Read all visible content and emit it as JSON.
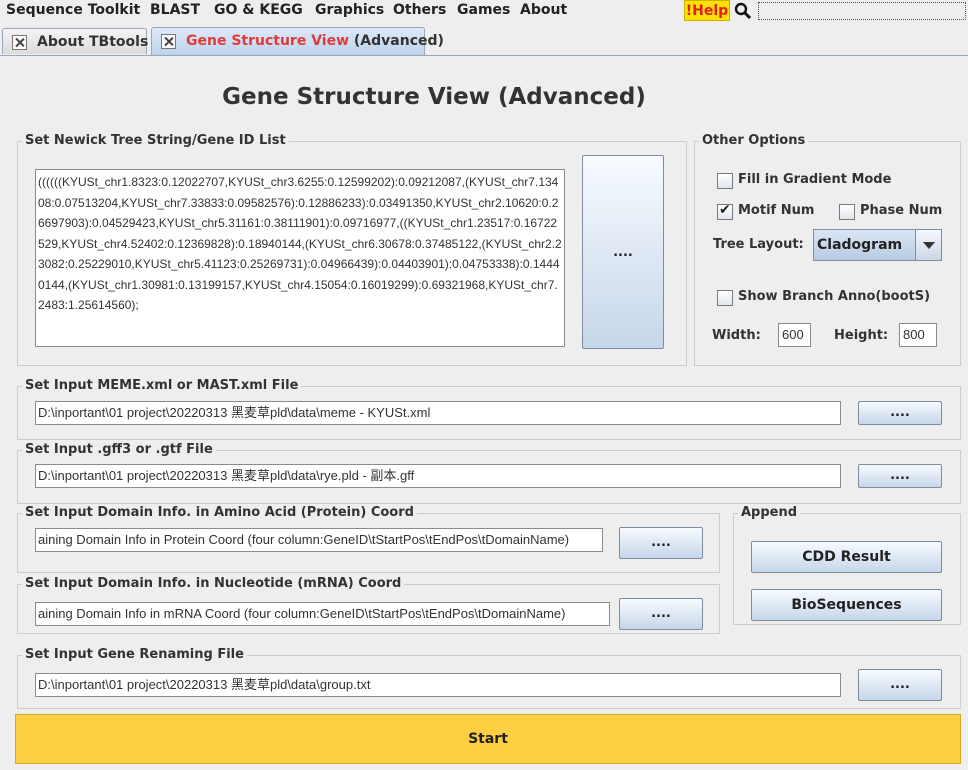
{
  "menu": {
    "items": [
      "Sequence Toolkit",
      "BLAST",
      "GO & KEGG",
      "Graphics",
      "Others",
      "Games",
      "About"
    ],
    "help_label": "!Help",
    "search_icon": "magnifier-icon"
  },
  "tabs": [
    {
      "label": "About TBtools"
    },
    {
      "label_prefix": "Gene Structure View",
      "label_suffix": " (Advanced)"
    }
  ],
  "page_title": "Gene Structure View (Advanced)",
  "newick": {
    "group_title": "Set Newick Tree String/Gene ID List",
    "value": "((((((KYUSt_chr1.8323:0.12022707,KYUSt_chr3.6255:0.12599202):0.09212087,(KYUSt_chr7.13408:0.07513204,KYUSt_chr7.33833:0.09582576):0.12886233):0.03491350,KYUSt_chr2.10620:0.26697903):0.04529423,KYUSt_chr5.31161:0.38111901):0.09716977,((KYUSt_chr1.23517:0.16722529,KYUSt_chr4.52402:0.12369828):0.18940144,(KYUSt_chr6.30678:0.37485122,(KYUSt_chr2.23082:0.25229010,KYUSt_chr5.41123:0.25269731):0.04966439):0.04403901):0.04753338):0.14440144,(KYUSt_chr1.30981:0.13199157,KYUSt_chr4.15054:0.16019299):0.69321968,KYUSt_chr7.2483:1.25614560);",
    "browse_label": "...."
  },
  "options": {
    "group_title": "Other Options",
    "fill_gradient_label": "Fill in Gradient Mode",
    "fill_gradient_checked": false,
    "motif_num_label": "Motif Num",
    "motif_num_checked": true,
    "phase_num_label": "Phase Num",
    "phase_num_checked": false,
    "tree_layout_label": "Tree Layout:",
    "tree_layout_value": "Cladogram",
    "show_branch_label": "Show Branch Anno(bootS)",
    "show_branch_checked": false,
    "width_label": "Width:",
    "width_value": "600",
    "height_label": "Height:",
    "height_value": "800"
  },
  "meme": {
    "group_title": "Set Input MEME.xml or MAST.xml File",
    "value": "D:\\inportant\\01 project\\20220313 黑麦草pld\\data\\meme - KYUSt.xml",
    "browse_label": "...."
  },
  "gff": {
    "group_title": "Set Input .gff3 or .gtf File",
    "value": "D:\\inportant\\01 project\\20220313 黑麦草pld\\data\\rye.pld - 副本.gff",
    "browse_label": "...."
  },
  "domain_protein": {
    "group_title": "Set Input Domain Info. in Amino Acid (Protein) Coord",
    "value": "aining Domain Info in Protein Coord (four column:GeneID\\tStartPos\\tEndPos\\tDomainName)",
    "browse_label": "...."
  },
  "domain_mrna": {
    "group_title": "Set Input Domain Info. in Nucleotide (mRNA) Coord",
    "value": "aining Domain Info in mRNA Coord (four column:GeneID\\tStartPos\\tEndPos\\tDomainName)",
    "browse_label": "...."
  },
  "append": {
    "group_title": "Append",
    "cdd_label": "CDD Result",
    "bioseq_label": "BioSequences"
  },
  "rename": {
    "group_title": "Set Input Gene Renaming File",
    "value": "D:\\inportant\\01 project\\20220313 黑麦草pld\\data\\group.txt",
    "browse_label": "...."
  },
  "start_label": "Start",
  "colors": {
    "start_button": "#fdd044",
    "help_background": "#ffe000",
    "help_text": "#e02020",
    "active_tab_text": "#e23a3a"
  }
}
